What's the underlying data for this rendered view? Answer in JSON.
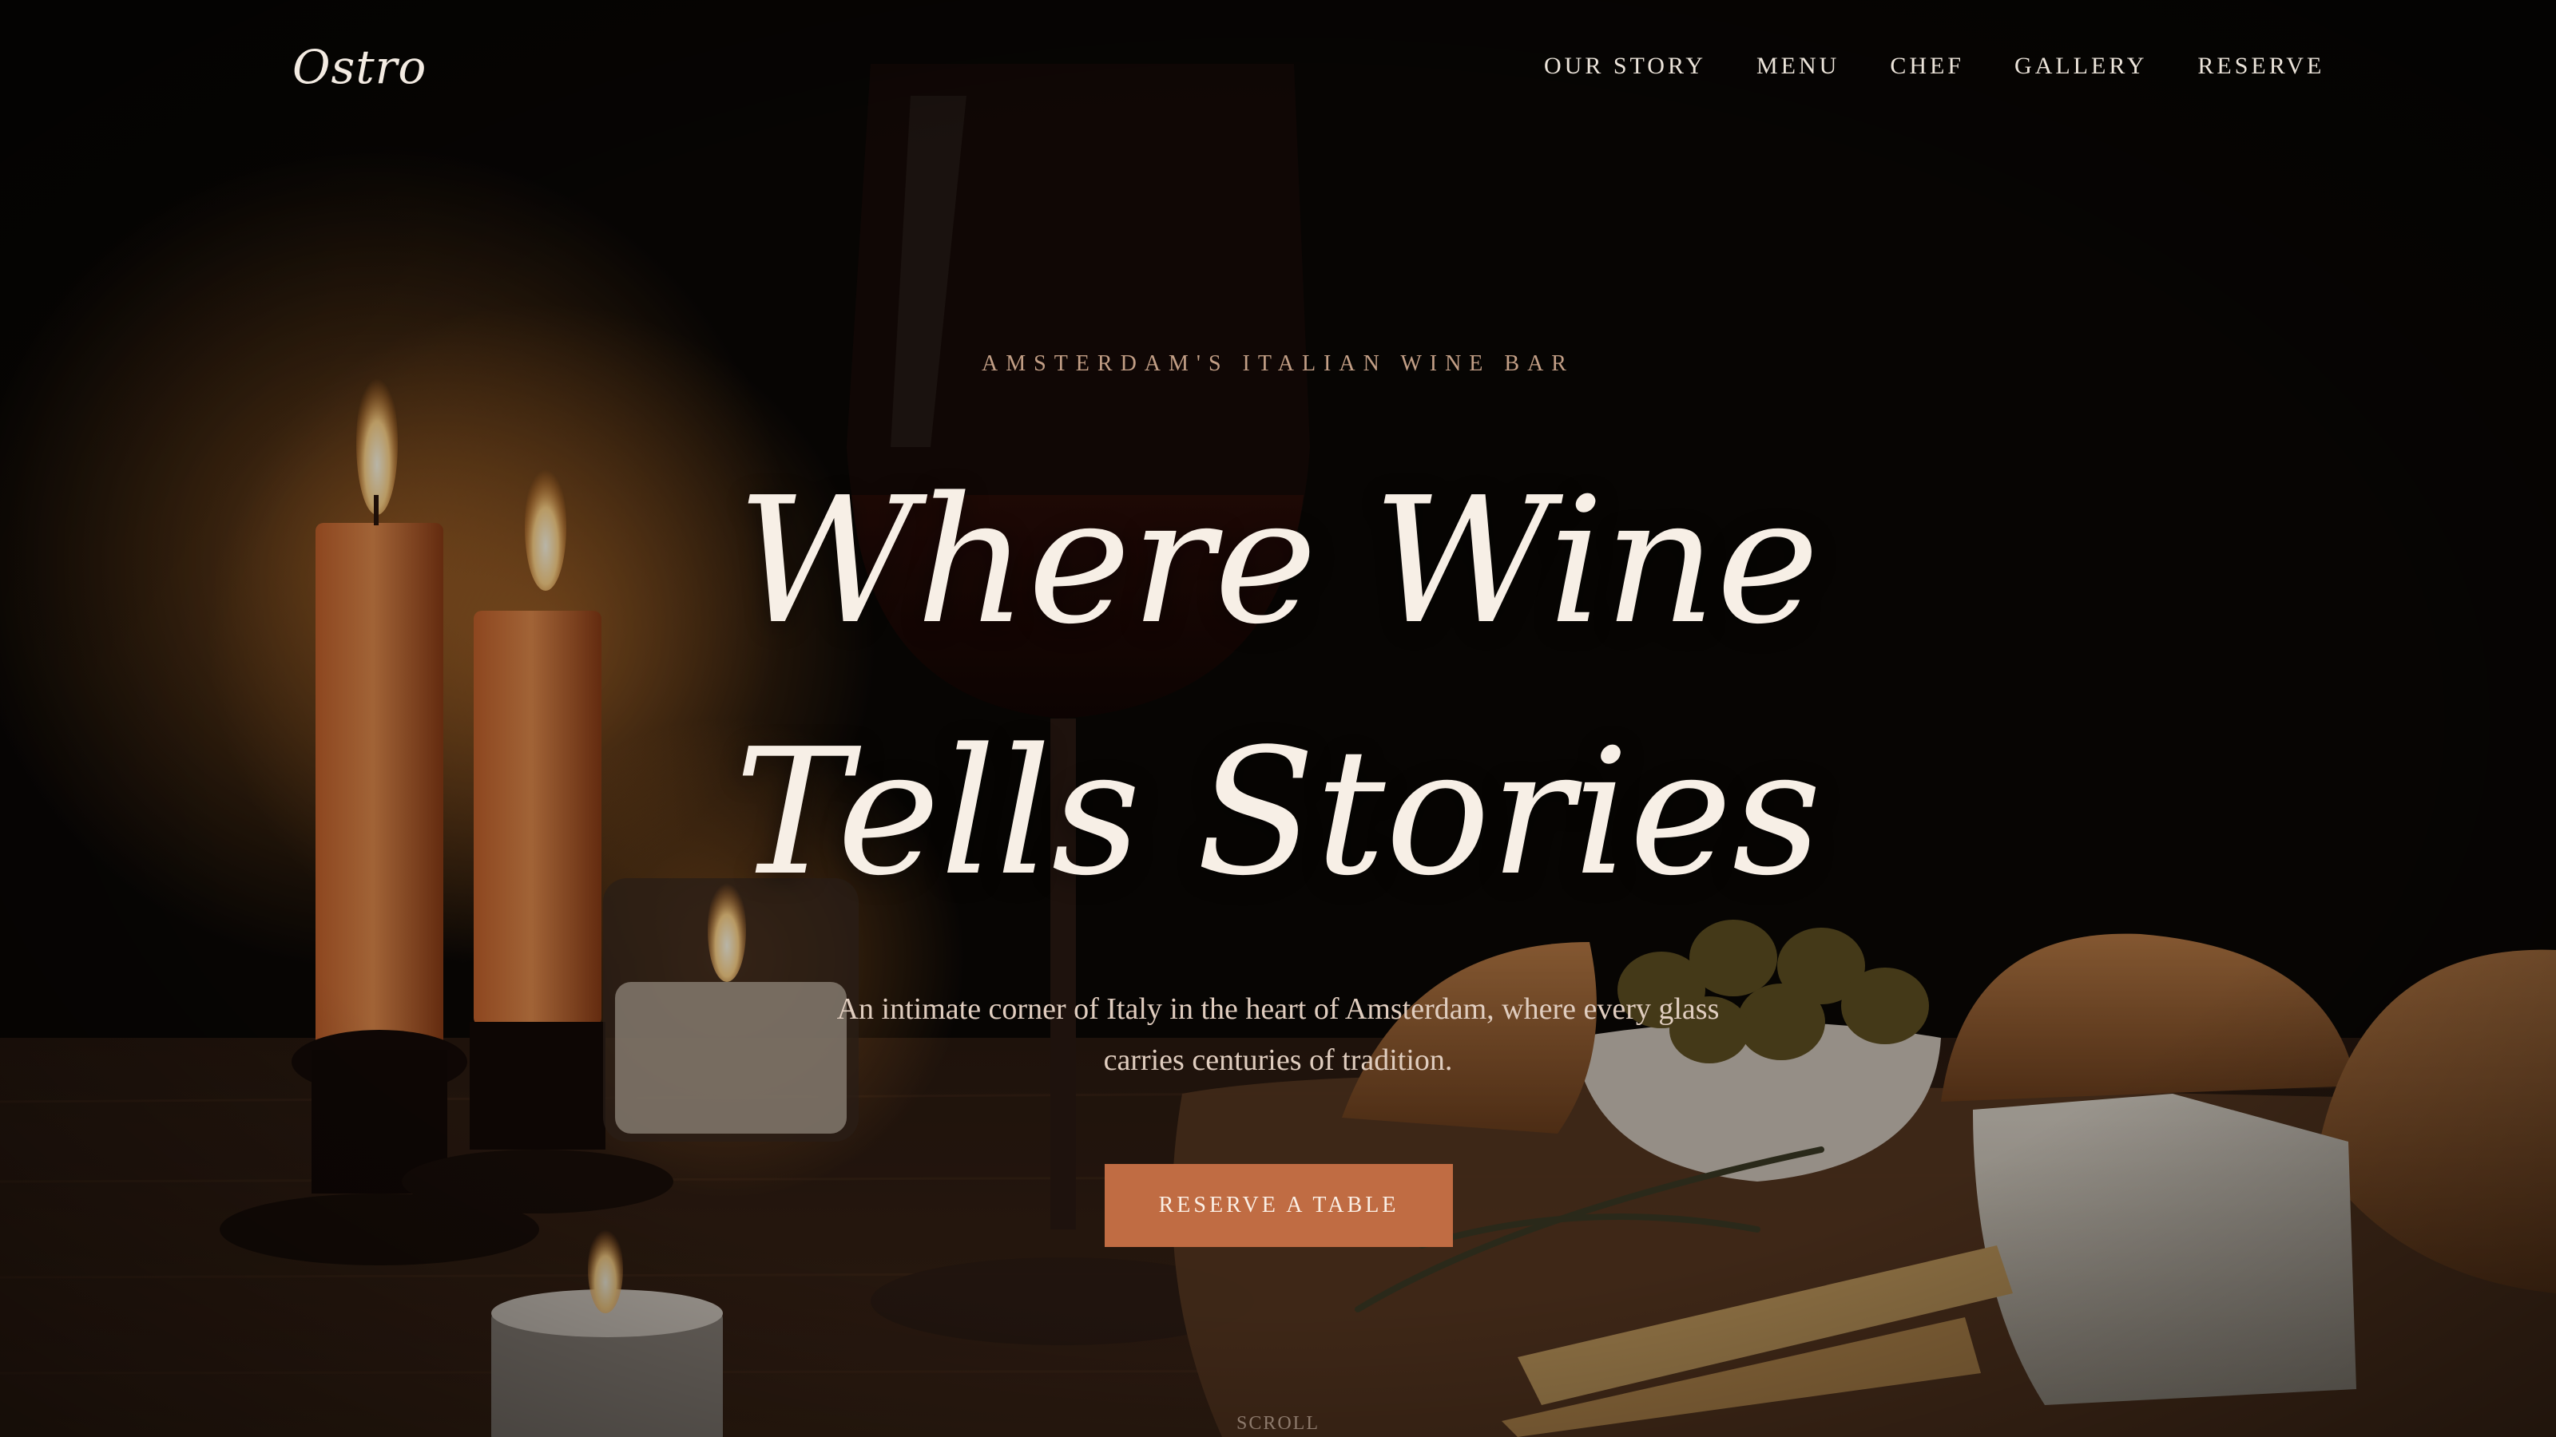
{
  "brand": {
    "logo": "Ostro"
  },
  "nav": {
    "items": [
      {
        "label": "OUR STORY"
      },
      {
        "label": "MENU"
      },
      {
        "label": "CHEF"
      },
      {
        "label": "GALLERY"
      },
      {
        "label": "RESERVE"
      }
    ]
  },
  "hero": {
    "eyebrow": "AMSTERDAM'S ITALIAN WINE BAR",
    "headline_line1": "Where Wine",
    "headline_line2": "Tells Stories",
    "subtitle": "An intimate corner of Italy in the heart of Amsterdam, where every glass carries centuries of tradition.",
    "cta_label": "RESERVE A TABLE",
    "scroll_label": "SCROLL"
  },
  "colors": {
    "accent": "#c06c43",
    "text_light": "#f7efe6",
    "eyebrow": "#c39f86",
    "background": "#0b0806"
  }
}
